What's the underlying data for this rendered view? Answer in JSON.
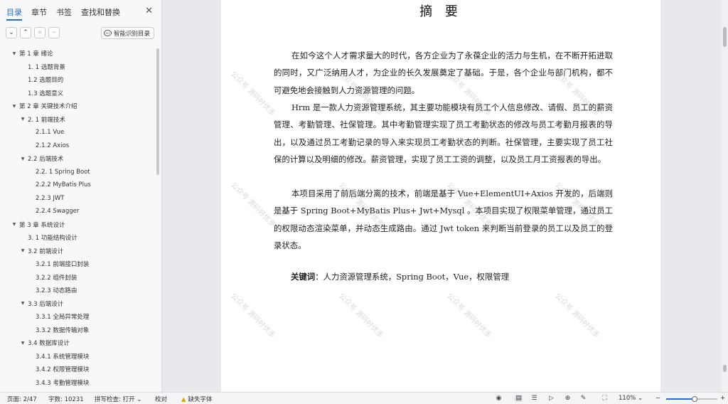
{
  "nav": {
    "tabs": [
      "目录",
      "章节",
      "书签",
      "查找和替换"
    ],
    "active_tab": 0,
    "toolbar": {
      "collapse": "⌄",
      "expand": "⌃",
      "add": "+",
      "remove": "−",
      "smart_label": "智能识别目录"
    },
    "toc": [
      {
        "label": "第 1 章 绪论",
        "level": 1,
        "arrow": true
      },
      {
        "label": "1. 1 选题背景",
        "level": 2,
        "arrow": false
      },
      {
        "label": "1.2 选题目的",
        "level": 2,
        "arrow": false
      },
      {
        "label": "1.3 选题意义",
        "level": 2,
        "arrow": false
      },
      {
        "label": "第 2 章 关键技术介绍",
        "level": 1,
        "arrow": true
      },
      {
        "label": "2. 1 前端技术",
        "level": 2,
        "arrow": true
      },
      {
        "label": "2.1.1     Vue",
        "level": 3,
        "arrow": false
      },
      {
        "label": "2.1.2     Axios",
        "level": 3,
        "arrow": false
      },
      {
        "label": "2.2  后端技术",
        "level": 2,
        "arrow": true
      },
      {
        "label": "2.2. 1 Spring Boot",
        "level": 3,
        "arrow": false
      },
      {
        "label": "2.2.2 MyBatis Plus",
        "level": 3,
        "arrow": false
      },
      {
        "label": "2.2.3 JWT",
        "level": 3,
        "arrow": false
      },
      {
        "label": "2.2.4 Swagger",
        "level": 3,
        "arrow": false
      },
      {
        "label": "第 3 章 系统设计",
        "level": 1,
        "arrow": true
      },
      {
        "label": "3. 1 功能结构设计",
        "level": 2,
        "arrow": false
      },
      {
        "label": "3.2 前端设计",
        "level": 2,
        "arrow": true
      },
      {
        "label": "3.2.1     前端接口封装",
        "level": 3,
        "arrow": false
      },
      {
        "label": "3.2.2     组件封装",
        "level": 3,
        "arrow": false
      },
      {
        "label": "3.2.3     动态路由",
        "level": 3,
        "arrow": false
      },
      {
        "label": "3.3 后端设计",
        "level": 2,
        "arrow": true
      },
      {
        "label": "3.3.1     全局异常处理",
        "level": 3,
        "arrow": false
      },
      {
        "label": "3.3.2     数据传输对象",
        "level": 3,
        "arrow": false
      },
      {
        "label": "3.4 数据库设计",
        "level": 2,
        "arrow": true
      },
      {
        "label": "3.4.1     系统管理模块",
        "level": 3,
        "arrow": false
      },
      {
        "label": "3.4.2     权限管理模块",
        "level": 3,
        "arrow": false
      },
      {
        "label": "3.4.3     考勤管理模块",
        "level": 3,
        "arrow": false
      }
    ]
  },
  "document": {
    "title": "摘  要",
    "paragraphs": [
      "在如今这个人才需求量大的时代，各方企业为了永葆企业的活力与生机，在不断开拓进取的同时，又广泛纳用人才，为企业的长久发展奠定了基础。于是，各个企业与部门机构，都不可避免地会接触到人力资源管理的问题。",
      "Hrm 是一款人力资源管理系统，其主要功能模块有员工个人信息修改、请假、员工的薪资管理、考勤管理、社保管理。其中考勤管理实现了员工考勤状态的修改与员工考勤月报表的导出，以及通过员工考勤记录的导入来实现员工考勤状态的判断。社保管理，主要实现了员工社保的计算以及明细的修改。薪资管理，实现了员工工资的调整，以及员工月工资报表的导出。",
      "本项目采用了前后端分离的技术，前端是基于 Vue+ElementUI+Axios 开发的，后端则是基于 Spring Boot+MyBatis Plus+ Jwt+Mysql 。本项目实现了权限菜单管理，通过员工的权限动态渲染菜单，并动态生成路由。通过 Jwt token 来判断当前登录的员工以及员工的登录状态。"
    ],
    "keywords_label": "关键词",
    "keywords_text": "：人力资源管理系统，Spring Boot，Vue，权限管理",
    "watermark": "公众号 源码好优多"
  },
  "status": {
    "page": "页面: 2/47",
    "words": "字数: 10231",
    "spellcheck": "拼写检查: 打开 ⌄",
    "proofread": "校对",
    "missing_font": "缺失字体",
    "zoom": "110% ⌄",
    "zoom_fraction": 0.55
  },
  "colors": {
    "accent": "#2a6bd8",
    "warning": "#e3a400"
  }
}
